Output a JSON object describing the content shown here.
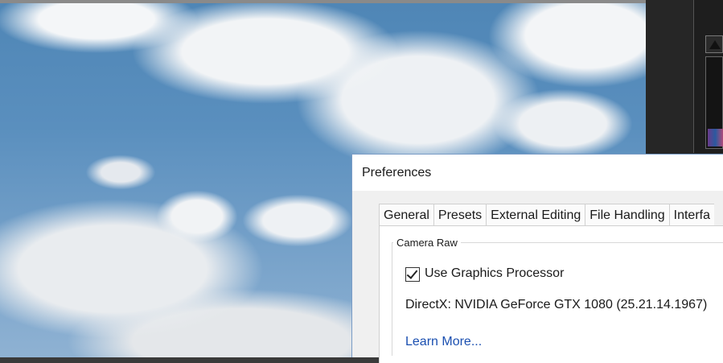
{
  "dialog": {
    "title": "Preferences",
    "tabs": [
      {
        "label": "General"
      },
      {
        "label": "Presets"
      },
      {
        "label": "External Editing"
      },
      {
        "label": "File Handling"
      },
      {
        "label": "Interfa"
      }
    ],
    "camera_raw": {
      "group_label": "Camera Raw",
      "use_gpu_label": "Use Graphics Processor",
      "use_gpu_checked": true,
      "gpu_info": "DirectX: NVIDIA GeForce GTX 1080 (25.21.14.1967)",
      "learn_more": "Learn More..."
    }
  },
  "colors": {
    "link": "#1a4fb0",
    "sky": "#5a8fbe",
    "dark_panel": "#262626"
  }
}
